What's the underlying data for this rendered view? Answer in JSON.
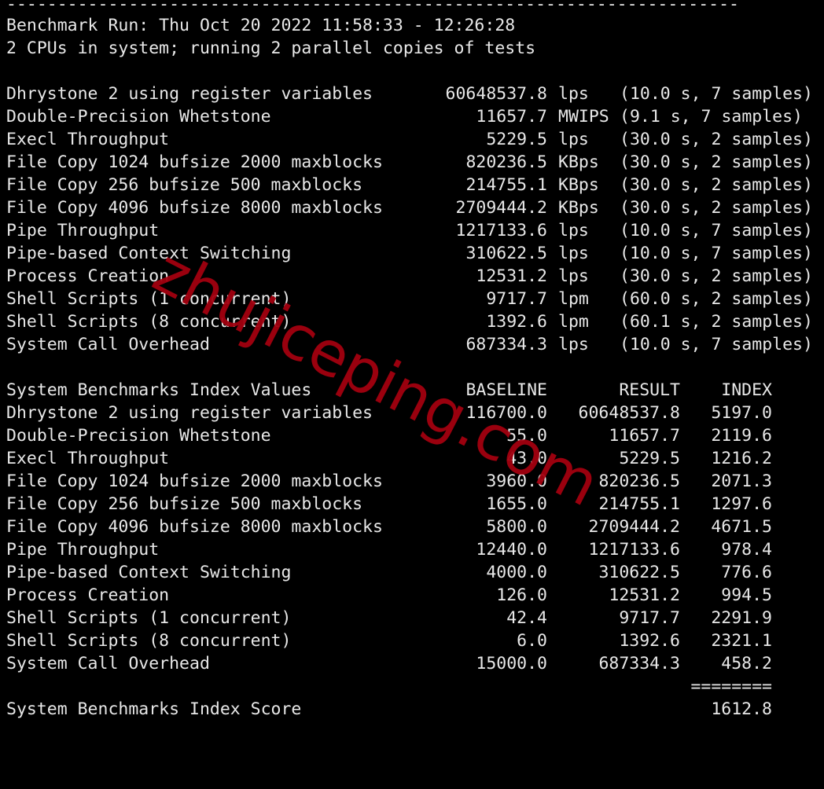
{
  "separator": "------------------------------------------------------------------------",
  "header": {
    "run_line": "Benchmark Run: Thu Oct 20 2022 11:58:33 - 12:26:28",
    "cpu_line": "2 CPUs in system; running 2 parallel copies of tests"
  },
  "results": [
    {
      "name": "Dhrystone 2 using register variables",
      "value": "60648537.8",
      "unit": "lps",
      "detail": "(10.0 s, 7 samples)"
    },
    {
      "name": "Double-Precision Whetstone",
      "value": "11657.7",
      "unit": "MWIPS",
      "detail": "(9.1 s, 7 samples)"
    },
    {
      "name": "Execl Throughput",
      "value": "5229.5",
      "unit": "lps",
      "detail": "(30.0 s, 2 samples)"
    },
    {
      "name": "File Copy 1024 bufsize 2000 maxblocks",
      "value": "820236.5",
      "unit": "KBps",
      "detail": "(30.0 s, 2 samples)"
    },
    {
      "name": "File Copy 256 bufsize 500 maxblocks",
      "value": "214755.1",
      "unit": "KBps",
      "detail": "(30.0 s, 2 samples)"
    },
    {
      "name": "File Copy 4096 bufsize 8000 maxblocks",
      "value": "2709444.2",
      "unit": "KBps",
      "detail": "(30.0 s, 2 samples)"
    },
    {
      "name": "Pipe Throughput",
      "value": "1217133.6",
      "unit": "lps",
      "detail": "(10.0 s, 7 samples)"
    },
    {
      "name": "Pipe-based Context Switching",
      "value": "310622.5",
      "unit": "lps",
      "detail": "(10.0 s, 7 samples)"
    },
    {
      "name": "Process Creation",
      "value": "12531.2",
      "unit": "lps",
      "detail": "(30.0 s, 2 samples)"
    },
    {
      "name": "Shell Scripts (1 concurrent)",
      "value": "9717.7",
      "unit": "lpm",
      "detail": "(60.0 s, 2 samples)"
    },
    {
      "name": "Shell Scripts (8 concurrent)",
      "value": "1392.6",
      "unit": "lpm",
      "detail": "(60.1 s, 2 samples)"
    },
    {
      "name": "System Call Overhead",
      "value": "687334.3",
      "unit": "lps",
      "detail": "(10.0 s, 7 samples)"
    }
  ],
  "index_table": {
    "title": "System Benchmarks Index Values",
    "columns": [
      "BASELINE",
      "RESULT",
      "INDEX"
    ],
    "rows": [
      {
        "name": "Dhrystone 2 using register variables",
        "baseline": "116700.0",
        "result": "60648537.8",
        "index": "5197.0"
      },
      {
        "name": "Double-Precision Whetstone",
        "baseline": "55.0",
        "result": "11657.7",
        "index": "2119.6"
      },
      {
        "name": "Execl Throughput",
        "baseline": "43.0",
        "result": "5229.5",
        "index": "1216.2"
      },
      {
        "name": "File Copy 1024 bufsize 2000 maxblocks",
        "baseline": "3960.0",
        "result": "820236.5",
        "index": "2071.3"
      },
      {
        "name": "File Copy 256 bufsize 500 maxblocks",
        "baseline": "1655.0",
        "result": "214755.1",
        "index": "1297.6"
      },
      {
        "name": "File Copy 4096 bufsize 8000 maxblocks",
        "baseline": "5800.0",
        "result": "2709444.2",
        "index": "4671.5"
      },
      {
        "name": "Pipe Throughput",
        "baseline": "12440.0",
        "result": "1217133.6",
        "index": "978.4"
      },
      {
        "name": "Pipe-based Context Switching",
        "baseline": "4000.0",
        "result": "310622.5",
        "index": "776.6"
      },
      {
        "name": "Process Creation",
        "baseline": "126.0",
        "result": "12531.2",
        "index": "994.5"
      },
      {
        "name": "Shell Scripts (1 concurrent)",
        "baseline": "42.4",
        "result": "9717.7",
        "index": "2291.9"
      },
      {
        "name": "Shell Scripts (8 concurrent)",
        "baseline": "6.0",
        "result": "1392.6",
        "index": "2321.1"
      },
      {
        "name": "System Call Overhead",
        "baseline": "15000.0",
        "result": "687334.3",
        "index": "458.2"
      }
    ],
    "score_separator": "========",
    "score_label": "System Benchmarks Index Score",
    "score_value": "1612.8"
  },
  "watermark": "zhujiceping.com",
  "colors": {
    "background": "#000000",
    "text": "#e8e8e8",
    "watermark": "#a3000f"
  }
}
